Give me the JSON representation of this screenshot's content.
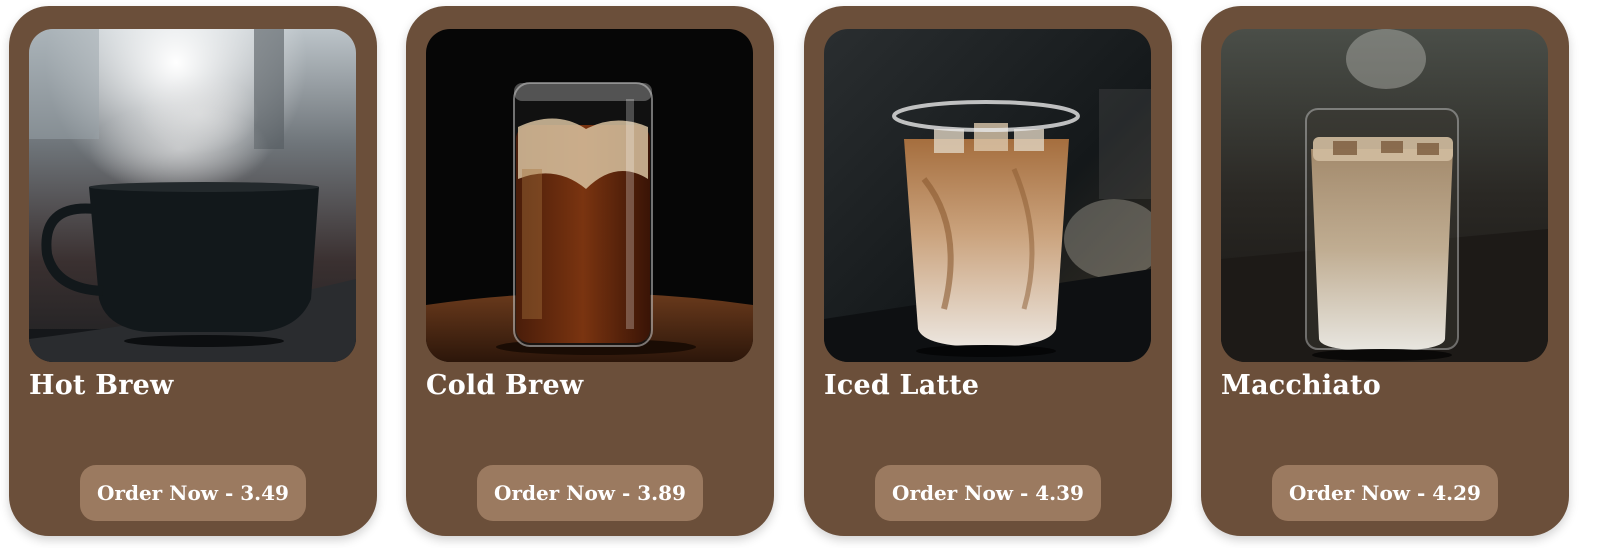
{
  "colors": {
    "card_background": "#6b4f3a",
    "button_background": "#9b7a60",
    "text": "#ffffff"
  },
  "products": [
    {
      "name": "Hot Brew",
      "button_prefix": "Order Now - ",
      "price": "3.49",
      "image": "steaming-black-coffee-cup-photo"
    },
    {
      "name": "Cold Brew",
      "button_prefix": "Order Now - ",
      "price": "3.89",
      "image": "iced-cold-brew-glass-photo"
    },
    {
      "name": "Iced Latte",
      "button_prefix": "Order Now - ",
      "price": "4.39",
      "image": "iced-latte-plastic-cup-photo"
    },
    {
      "name": "Macchiato",
      "button_prefix": "Order Now - ",
      "price": "4.29",
      "image": "macchiato-glass-photo"
    }
  ]
}
